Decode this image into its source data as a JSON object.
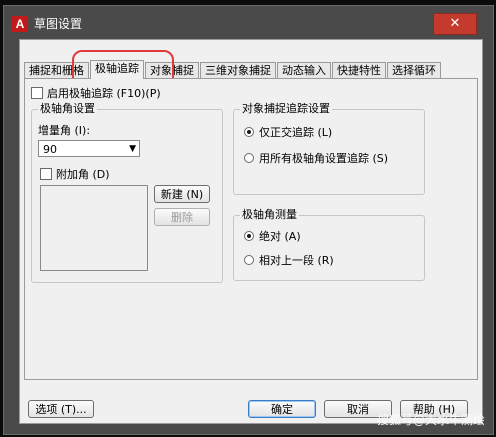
{
  "window": {
    "title": "草图设置",
    "app_icon_text": "A",
    "close_symbol": "✕"
  },
  "tabs": [
    {
      "label": "捕捉和栅格",
      "active": false
    },
    {
      "label": "极轴追踪",
      "active": true
    },
    {
      "label": "对象捕捉",
      "active": false
    },
    {
      "label": "三维对象捕捉",
      "active": false
    },
    {
      "label": "动态输入",
      "active": false
    },
    {
      "label": "快捷特性",
      "active": false
    },
    {
      "label": "选择循环",
      "active": false
    }
  ],
  "polar": {
    "enable_label": "启用极轴追踪 (F10)(P)",
    "angle_group_title": "极轴角设置",
    "increment_label": "增量角 (I):",
    "increment_value": "90",
    "additional_label": "附加角 (D)",
    "new_button": "新建 (N)",
    "delete_button": "删除"
  },
  "snap_tracking": {
    "title": "对象捕捉追踪设置",
    "option1": "仅正交追踪 (L)",
    "option2": "用所有极轴角设置追踪 (S)",
    "selected": "option1"
  },
  "measurement": {
    "title": "极轴角测量",
    "option1": "绝对 (A)",
    "option2": "相对上一段 (R)",
    "selected": "option1"
  },
  "footer": {
    "options_button": "选项 (T)...",
    "ok_button": "确定",
    "cancel_button": "取消",
    "help_button": "帮助 (H)"
  },
  "watermark": "搜狐号@大水牛测绘",
  "colors": {
    "highlight_ring": "#e23a3a",
    "close_button": "#c43b2e",
    "app_icon": "#c21a1a"
  }
}
